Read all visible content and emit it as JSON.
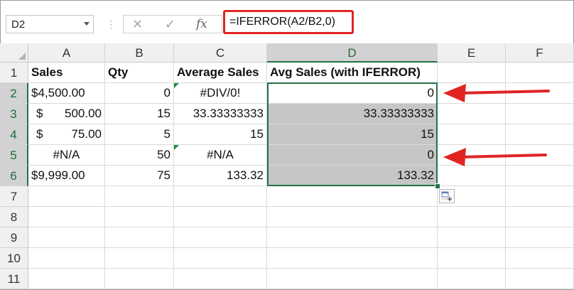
{
  "name_box": {
    "value": "D2"
  },
  "formula_bar": {
    "formula": "=IFERROR(A2/B2,0)",
    "cancel_icon": "x-icon",
    "enter_icon": "check-icon",
    "function_icon": "fx-icon",
    "fx_label": "fx"
  },
  "columns": [
    "A",
    "B",
    "C",
    "D",
    "E",
    "F"
  ],
  "rows": [
    "1",
    "2",
    "3",
    "4",
    "5",
    "6",
    "7",
    "8",
    "9",
    "10",
    "11"
  ],
  "cells": {
    "header": {
      "sales": "Sales",
      "qty": "Qty",
      "avg": "Average Sales",
      "avg_iferror": "Avg Sales (with IFERROR)"
    },
    "r2": {
      "sales": "$4,500.00",
      "qty": "0",
      "avg": "#DIV/0!",
      "iferror": "0"
    },
    "r3": {
      "sales_sym": "$",
      "sales": "500.00",
      "qty": "15",
      "avg": "33.33333333",
      "iferror": "33.33333333"
    },
    "r4": {
      "sales_sym": "$",
      "sales": "75.00",
      "qty": "5",
      "avg": "15",
      "iferror": "15"
    },
    "r5": {
      "sales": "#N/A",
      "qty": "50",
      "avg": "#N/A",
      "iferror": "0"
    },
    "r6": {
      "sales": "$9,999.00",
      "qty": "75",
      "avg": "133.32",
      "iferror": "133.32"
    }
  },
  "colors": {
    "selection": "#217346",
    "highlight": "#c6c6c6",
    "annotation": "#e02424",
    "error_indicator": "#1e8b3e"
  }
}
